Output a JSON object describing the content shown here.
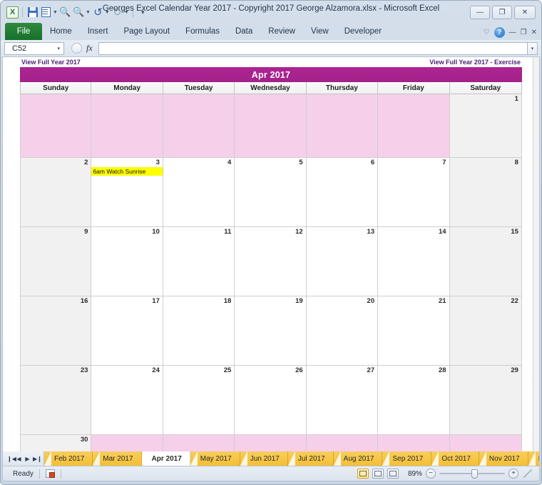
{
  "window": {
    "title": "Georges Excel Calendar Year 2017  -  Copyright 2017 George Alzamora.xlsx  -  Microsoft Excel",
    "minimize_label": "—",
    "restore_label": "❐",
    "close_label": "✕"
  },
  "quick_access": {
    "app_logo": "X",
    "save_label": "save-icon",
    "print_preview_label": "print-preview-icon",
    "find_label": "find-icon",
    "find2_label": "find-next-icon",
    "undo_label": "↺",
    "redo_label": "↻",
    "customize_label": "▾"
  },
  "ribbon": {
    "file_label": "File",
    "tabs": [
      {
        "label": "Home"
      },
      {
        "label": "Insert"
      },
      {
        "label": "Page Layout"
      },
      {
        "label": "Formulas"
      },
      {
        "label": "Data"
      },
      {
        "label": "Review"
      },
      {
        "label": "View"
      },
      {
        "label": "Developer"
      }
    ],
    "minimize_ribbon_label": "♡",
    "help_label": "?",
    "win_min_label": "—",
    "win_restore_label": "❐",
    "win_close_label": "✕"
  },
  "formula_bar": {
    "name_box_value": "C52",
    "name_box_caret": "▾",
    "fx_label": "fx",
    "formula_value": "",
    "expand_caret": "▾"
  },
  "links": {
    "left": "View Full Year 2017",
    "right": "View Full Year 2017 - Exercise"
  },
  "calendar": {
    "month_title": "Apr 2017",
    "day_headers": [
      "Sunday",
      "Monday",
      "Tuesday",
      "Wednesday",
      "Thursday",
      "Friday",
      "Saturday"
    ],
    "header_color": "#a9238f",
    "blank_fill_color": "#f6cfea",
    "weekend_fill_color": "#f1f1f1",
    "event_fill_color": "#ffff00",
    "weeks": [
      [
        {
          "day": "",
          "state": "blank",
          "event": ""
        },
        {
          "day": "",
          "state": "blank",
          "event": ""
        },
        {
          "day": "",
          "state": "blank",
          "event": ""
        },
        {
          "day": "",
          "state": "blank",
          "event": ""
        },
        {
          "day": "",
          "state": "blank",
          "event": ""
        },
        {
          "day": "",
          "state": "blank",
          "event": ""
        },
        {
          "day": "1",
          "state": "weekend",
          "event": ""
        }
      ],
      [
        {
          "day": "2",
          "state": "weekend",
          "event": ""
        },
        {
          "day": "3",
          "state": "normal",
          "event": "6am Watch Sunrise"
        },
        {
          "day": "4",
          "state": "normal",
          "event": ""
        },
        {
          "day": "5",
          "state": "normal",
          "event": ""
        },
        {
          "day": "6",
          "state": "normal",
          "event": ""
        },
        {
          "day": "7",
          "state": "normal",
          "event": ""
        },
        {
          "day": "8",
          "state": "weekend",
          "event": ""
        }
      ],
      [
        {
          "day": "9",
          "state": "weekend",
          "event": ""
        },
        {
          "day": "10",
          "state": "normal",
          "event": ""
        },
        {
          "day": "11",
          "state": "normal",
          "event": ""
        },
        {
          "day": "12",
          "state": "normal",
          "event": ""
        },
        {
          "day": "13",
          "state": "normal",
          "event": ""
        },
        {
          "day": "14",
          "state": "normal",
          "event": ""
        },
        {
          "day": "15",
          "state": "weekend",
          "event": ""
        }
      ],
      [
        {
          "day": "16",
          "state": "weekend",
          "event": ""
        },
        {
          "day": "17",
          "state": "normal",
          "event": ""
        },
        {
          "day": "18",
          "state": "normal",
          "event": ""
        },
        {
          "day": "19",
          "state": "normal",
          "event": ""
        },
        {
          "day": "20",
          "state": "normal",
          "event": ""
        },
        {
          "day": "21",
          "state": "normal",
          "event": ""
        },
        {
          "day": "22",
          "state": "weekend",
          "event": ""
        }
      ],
      [
        {
          "day": "23",
          "state": "weekend",
          "event": ""
        },
        {
          "day": "24",
          "state": "normal",
          "event": ""
        },
        {
          "day": "25",
          "state": "normal",
          "event": ""
        },
        {
          "day": "26",
          "state": "normal",
          "event": ""
        },
        {
          "day": "27",
          "state": "normal",
          "event": ""
        },
        {
          "day": "28",
          "state": "normal",
          "event": ""
        },
        {
          "day": "29",
          "state": "weekend",
          "event": ""
        }
      ],
      [
        {
          "day": "30",
          "state": "weekend",
          "event": ""
        },
        {
          "day": "",
          "state": "blank",
          "event": ""
        },
        {
          "day": "",
          "state": "blank",
          "event": ""
        },
        {
          "day": "",
          "state": "blank",
          "event": ""
        },
        {
          "day": "",
          "state": "blank",
          "event": ""
        },
        {
          "day": "",
          "state": "blank",
          "event": ""
        },
        {
          "day": "",
          "state": "blank",
          "event": ""
        }
      ]
    ]
  },
  "sheet_tabs": {
    "nav_first": "❙◀",
    "nav_prev": "◀",
    "nav_next": "▶",
    "nav_last": "▶❙",
    "tabs": [
      {
        "label": "Feb 2017",
        "active": false
      },
      {
        "label": "Mar 2017",
        "active": false
      },
      {
        "label": "Apr 2017",
        "active": true
      },
      {
        "label": "May 2017",
        "active": false
      },
      {
        "label": "Jun 2017",
        "active": false
      },
      {
        "label": "Jul 2017",
        "active": false
      },
      {
        "label": "Aug 2017",
        "active": false
      },
      {
        "label": "Sep 2017",
        "active": false
      },
      {
        "label": "Oct 2017",
        "active": false
      },
      {
        "label": "Nov 2017",
        "active": false
      },
      {
        "label": "D",
        "active": false
      }
    ]
  },
  "status_bar": {
    "state": "Ready",
    "macro_record_label": "record-macro-icon",
    "view_normal_label": "normal-view-icon",
    "view_layout_label": "page-layout-view-icon",
    "view_break_label": "page-break-view-icon",
    "zoom_percent": "89%",
    "zoom_out_label": "−",
    "zoom_in_label": "+"
  }
}
